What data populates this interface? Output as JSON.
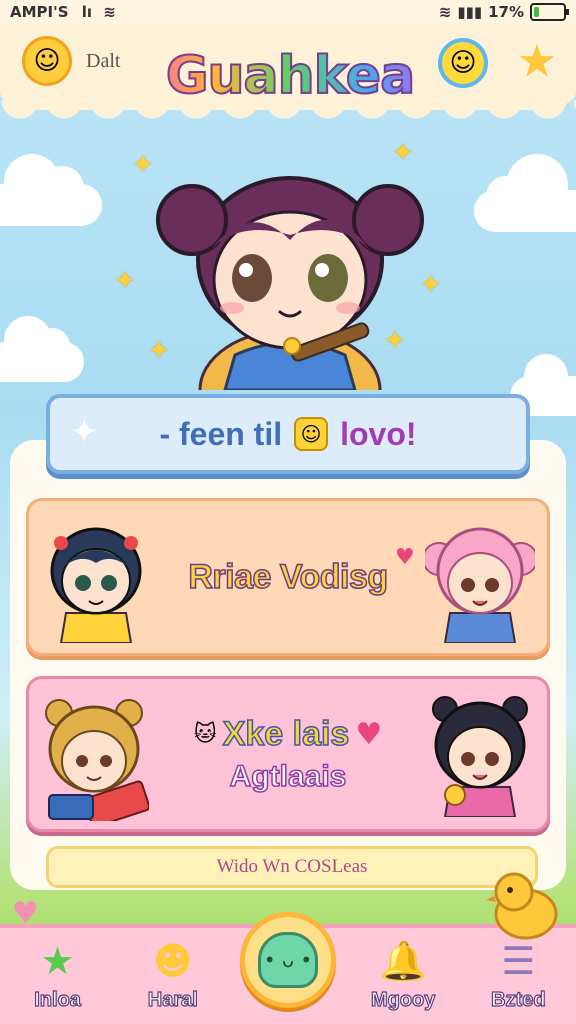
{
  "status_bar": {
    "carrier": "AMPI'S",
    "signal_text": "lı",
    "battery": "17%",
    "battery_level": 0.17
  },
  "header": {
    "user_label": "Dalt",
    "app_title": "Guahkea",
    "left_icon": "sun-mascot-icon",
    "right_icons": [
      "smile-icon",
      "star-icon"
    ]
  },
  "banner": {
    "text_before": "- feen til",
    "text_after": "lovo!",
    "emoji_icon": "smile-face-icon",
    "sparkle_icon": "sparkle-icon"
  },
  "cards": [
    {
      "title": "Rriae Vodisg",
      "subtitle": "",
      "background": "#ffd8b8",
      "left_character": "chibi-boy-yellow-shirt",
      "right_character": "chibi-girl-pink-hair"
    },
    {
      "title": "Xke lais",
      "subtitle": "Agtlaais",
      "background": "#ffc2d6",
      "left_character": "chibi-bear-reading",
      "right_character": "chibi-girl-black-hair"
    }
  ],
  "footer_bar": {
    "text": "Wido Wn COSLeas"
  },
  "nav": {
    "items": [
      {
        "label": "Inloa",
        "icon": "star-icon"
      },
      {
        "label": "Haral",
        "icon": "smile-icon"
      },
      {
        "label": "",
        "icon": "slime-home-icon"
      },
      {
        "label": "Mgooy",
        "icon": "bell-icon"
      },
      {
        "label": "Bzted",
        "icon": "menu-list-icon"
      }
    ]
  },
  "colors": {
    "accent_pink": "#ffc2d6",
    "accent_peach": "#ffd8b8",
    "banner_blue": "#dcecfa",
    "sky": "#bfe6f7",
    "yellow": "#ffd23a"
  }
}
